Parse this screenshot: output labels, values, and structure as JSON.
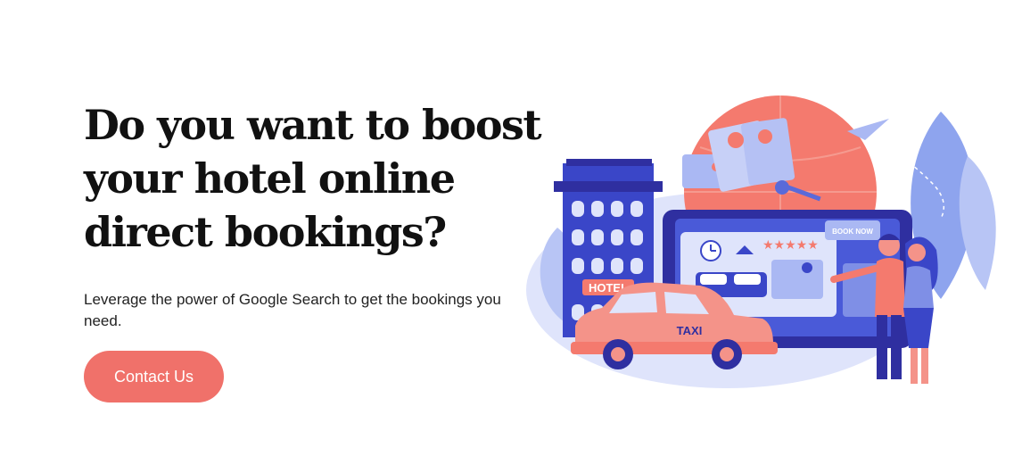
{
  "hero": {
    "title_lines": [
      "Do you want to boost",
      "your hotel online",
      "direct bookings?"
    ],
    "subtitle": "Leverage the power of Google Search to get the bookings you need.",
    "cta_label": "Contact Us"
  },
  "illustration": {
    "hotel_sign": "HOTEL",
    "taxi_sign": "TAXI",
    "book_now_label": "BOOK NOW",
    "rating_stars": "★★★★★"
  },
  "colors": {
    "accent": "#f0716a",
    "navy": "#2f2fa0",
    "blue": "#4a5ad8",
    "light_blue": "#aab8f3"
  }
}
